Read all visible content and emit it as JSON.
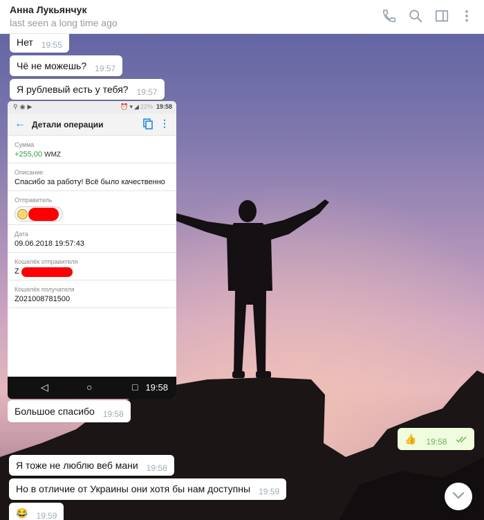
{
  "header": {
    "contact_name": "Анна Лукьянчук",
    "status": "last seen a long time ago",
    "icons": [
      "phone-icon",
      "search-icon",
      "sidebar-toggle-icon",
      "more-vertical-icon"
    ]
  },
  "messages": [
    {
      "text": "Нет",
      "time": "19:55",
      "direction": "in"
    },
    {
      "text": "Чё не можешь?",
      "time": "19:57",
      "direction": "in"
    },
    {
      "text": "Я рублевый есть у тебя?",
      "time": "19:57",
      "direction": "in"
    },
    {
      "text": "Большое спасибо",
      "time": "19:58",
      "direction": "in"
    },
    {
      "text": "Я тоже не люблю веб мани",
      "time": "19:58",
      "direction": "in"
    },
    {
      "text": "Но в отличие от Украины они хотя бы нам доступны",
      "time": "19:59",
      "direction": "in"
    },
    {
      "text": "😂",
      "time": "19:59",
      "direction": "in"
    }
  ],
  "outgoing": {
    "emoji": "👍",
    "time": "19:58",
    "read": true
  },
  "screenshot": {
    "status_time": "19:58",
    "status_battery": "22%",
    "title": "Детали операции",
    "fields": [
      {
        "label": "Сумма",
        "value": "+255,00",
        "unit": "WMZ"
      },
      {
        "label": "Описание",
        "value": "Спасибо за работу! Всё было качественно"
      },
      {
        "label": "Отправитель",
        "value": ""
      },
      {
        "label": "Дата",
        "value": "09.06.2018 19:57:43"
      },
      {
        "label": "Кошелёк отправителя",
        "value": "Z"
      },
      {
        "label": "Кошелёк получателя",
        "value": "Z021008781500"
      }
    ],
    "nav_time": "19:58"
  }
}
